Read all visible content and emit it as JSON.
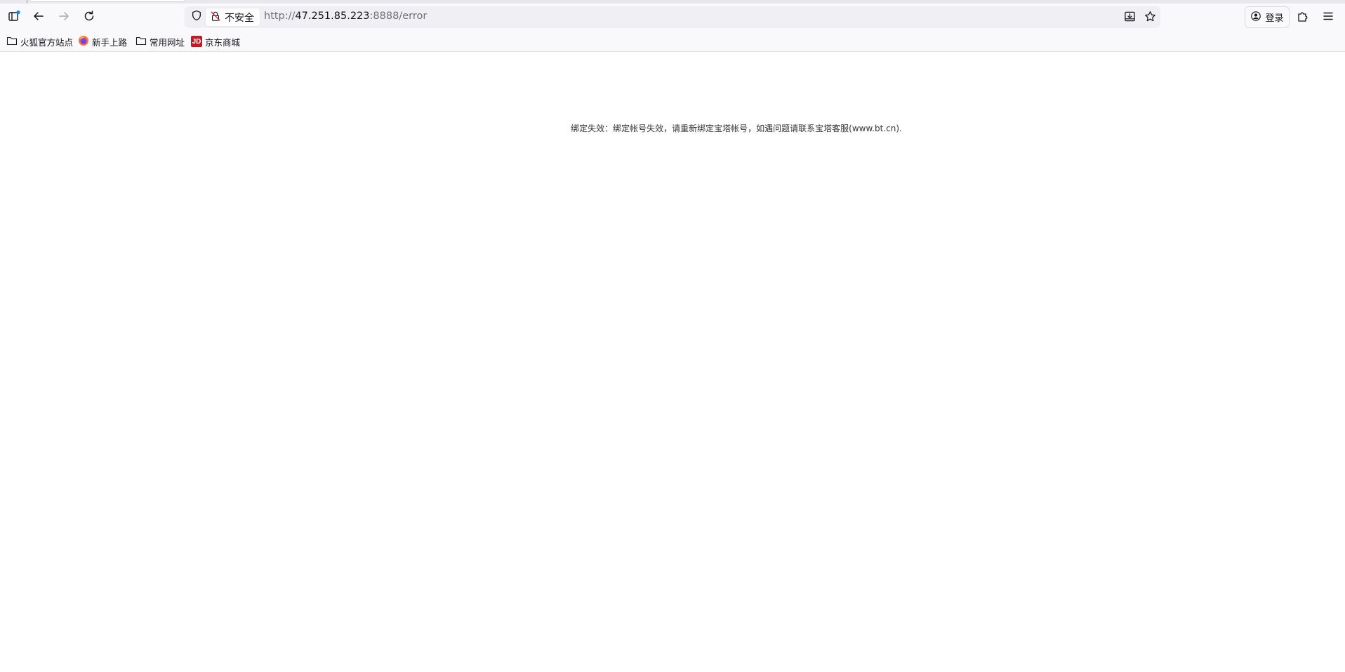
{
  "browser": {
    "toolbar": {
      "security_label": "不安全",
      "url_prefix": "http://",
      "url_host": "47.251.85.223",
      "url_suffix": ":8888/error",
      "login_label": "登录"
    },
    "bookmarks": [
      {
        "label": "火狐官方站点",
        "icon": "folder-icon"
      },
      {
        "label": "新手上路",
        "icon": "firefox-icon"
      },
      {
        "label": "常用网址",
        "icon": "folder-icon"
      },
      {
        "label": "京东商城",
        "icon": "jd-icon"
      }
    ]
  },
  "page": {
    "error_message": "绑定失效：绑定帐号失效，请重新绑定宝塔帐号，如遇问题请联系宝塔客服(www.bt.cn)."
  },
  "colors": {
    "toolbar_bg": "#f9f9fb",
    "urlbar_bg": "#f0f0f4",
    "jd_red": "#c81623",
    "insecure_red": "#e22850"
  }
}
